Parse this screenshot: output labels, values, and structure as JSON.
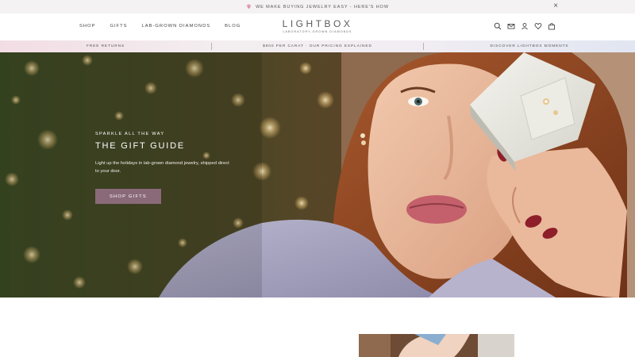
{
  "announcement": {
    "text": "WE MAKE BUYING JEWELRY EASY - HERE'S HOW",
    "icon": "diamond-icon",
    "close_icon": "close-icon"
  },
  "header": {
    "nav": [
      "SHOP",
      "GIFTS",
      "LAB-GROWN DIAMONDS",
      "BLOG"
    ],
    "logo": {
      "name": "LIGHTBOX",
      "tagline": "LABORATORY-GROWN DIAMONDS"
    },
    "icons": [
      "search-icon",
      "mail-icon",
      "account-icon",
      "heart-icon",
      "bag-icon"
    ]
  },
  "promo": [
    "FREE RETURNS",
    "$800 PER CARAT · OUR PRICING EXPLAINED",
    "DISCOVER LIGHTBOX MOMENTS"
  ],
  "hero": {
    "eyebrow": "SPARKLE ALL THE WAY",
    "title": "THE GIFT GUIDE",
    "description": "Light up the holidays in lab-grown diamond jewelry, shipped direct to your door.",
    "button": "SHOP GIFTS",
    "button_color": "#8a6979"
  },
  "colors": {
    "announcement_bg": "#f4f2f2",
    "promo_gradient_start": "#f2dde4",
    "promo_gradient_end": "#e1e6f2"
  }
}
